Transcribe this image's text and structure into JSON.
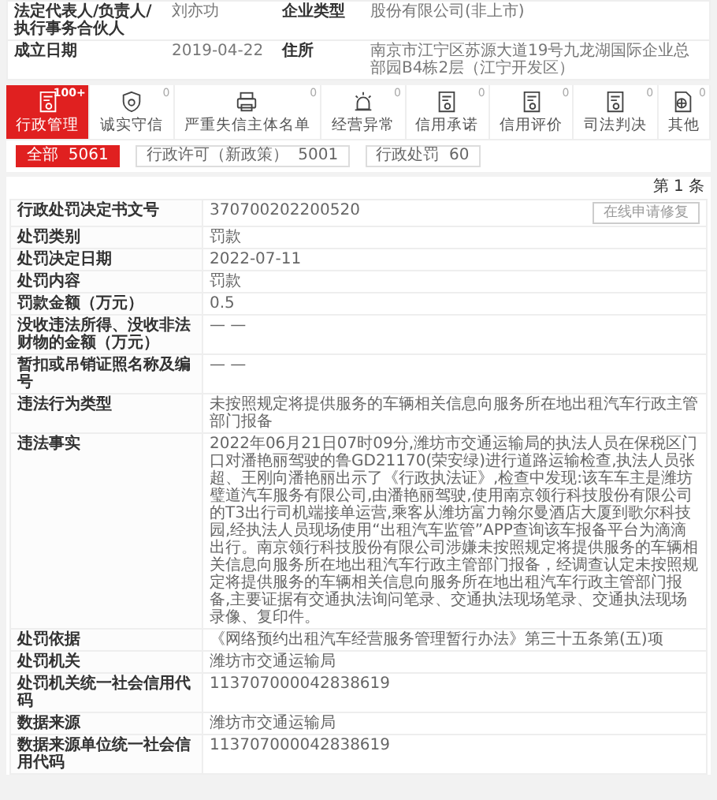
{
  "company_info": [
    {
      "label": "法定代表人/负责人/执行事务合伙人",
      "value": "刘亦功",
      "label2": "企业类型",
      "value2": "股份有限公司(非上市)"
    },
    {
      "label": "成立日期",
      "value": "2019-04-22",
      "label2": "住所",
      "value2": "南京市江宁区苏源大道19号九龙湖国际企业总部园B4栋2层（江宁开发区）"
    }
  ],
  "tabs": [
    {
      "label": "行政管理",
      "count": "100+",
      "selected": true
    },
    {
      "label": "诚实守信",
      "count": "0",
      "selected": false
    },
    {
      "label": "严重失信主体名单",
      "count": "0",
      "selected": false
    },
    {
      "label": "经营异常",
      "count": "0",
      "selected": false
    },
    {
      "label": "信用承诺",
      "count": "0",
      "selected": false
    },
    {
      "label": "信用评价",
      "count": "0",
      "selected": false
    },
    {
      "label": "司法判决",
      "count": "0",
      "selected": false
    },
    {
      "label": "其他",
      "count": "0",
      "selected": false
    }
  ],
  "filters": [
    {
      "label": "全部",
      "count": "5061",
      "selected": true
    },
    {
      "label": "行政许可（新政策）",
      "count": "5001",
      "selected": false
    },
    {
      "label": "行政处罚",
      "count": "60",
      "selected": false
    }
  ],
  "record_index": "第 1 条",
  "details": [
    {
      "label": "行政处罚决定书文号",
      "value": "370700202200520",
      "action": "在线申请修复"
    },
    {
      "label": "处罚类别",
      "value": "罚款"
    },
    {
      "label": "处罚决定日期",
      "value": "2022-07-11"
    },
    {
      "label": "处罚内容",
      "value": "罚款"
    },
    {
      "label": "罚款金额（万元）",
      "value": "0.5"
    },
    {
      "label": "没收违法所得、没收非法财物的金额（万元）",
      "value": "— —"
    },
    {
      "label": "暂扣或吊销证照名称及编号",
      "value": "— —"
    },
    {
      "label": "违法行为类型",
      "value": "未按照规定将提供服务的车辆相关信息向服务所在地出租汽车行政主管部门报备"
    },
    {
      "label": "违法事实",
      "value": "2022年06月21日07时09分,潍坊市交通运输局的执法人员在保税区门口对潘艳丽驾驶的鲁GD21170(荣安绿)进行道路运输检查,执法人员张超、王刚向潘艳丽出示了《行政执法证》,检查中发现:该车车主是潍坊璧道汽车服务有限公司,由潘艳丽驾驶,使用南京领行科技股份有限公司的T3出行司机端接单运营,乘客从潍坊富力翰尔曼酒店大厦到歌尔科技园,经执法人员现场使用“出租汽车监管”APP查询该车报备平台为滴滴出行。南京领行科技股份有限公司涉嫌未按照规定将提供服务的车辆相关信息向服务所在地出租汽车行政主管部门报备，经调查认定未按照规定将提供服务的车辆相关信息向服务所在地出租汽车行政主管部门报备,主要证据有交通执法询问笔录、交通执法现场笔录、交通执法现场录像、复印件。"
    },
    {
      "label": "处罚依据",
      "value": "《网络预约出租汽车经营服务管理暂行办法》第三十五条第(五)项"
    },
    {
      "label": "处罚机关",
      "value": "潍坊市交通运输局"
    },
    {
      "label": "处罚机关统一社会信用代码",
      "value": "113707000042838619"
    },
    {
      "label": "数据来源",
      "value": "潍坊市交通运输局"
    },
    {
      "label": "数据来源单位统一社会信用代码",
      "value": "113707000042838619"
    }
  ]
}
